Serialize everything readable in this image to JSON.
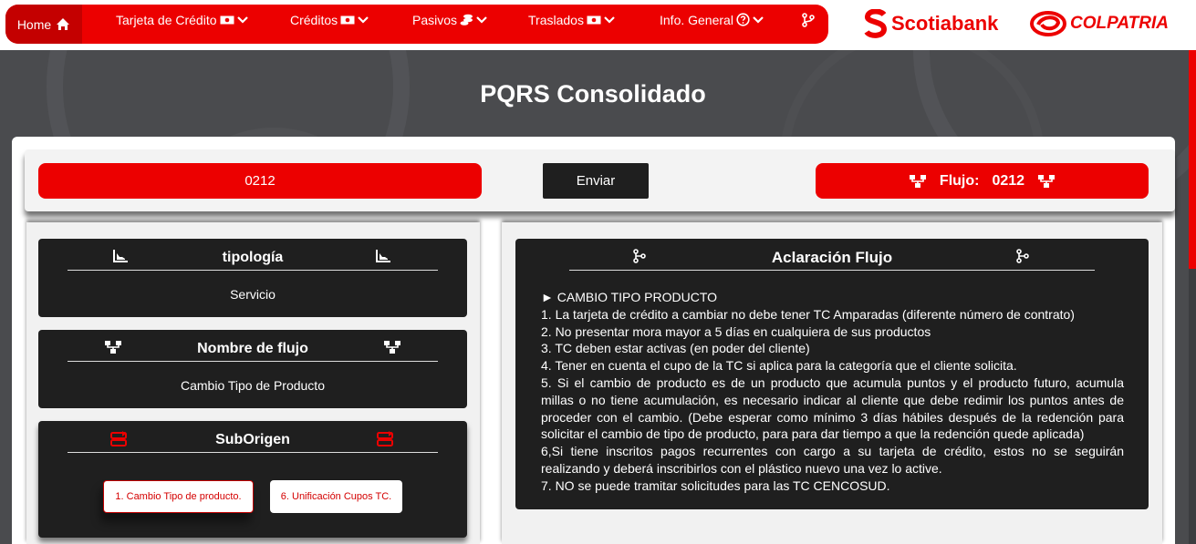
{
  "nav": {
    "home": "Home",
    "items": [
      {
        "label": "Tarjeta de Crédito"
      },
      {
        "label": "Créditos"
      },
      {
        "label": "Pasivos"
      },
      {
        "label": "Traslados"
      },
      {
        "label": "Info. General"
      }
    ]
  },
  "brand": {
    "scotiabank": "Scotiabank",
    "colpatria": "COLPATRIA"
  },
  "page": {
    "title": "PQRS Consolidado"
  },
  "search": {
    "value": "0212",
    "send_label": "Enviar",
    "flow_label": "Flujo:",
    "flow_value": "0212"
  },
  "cards": {
    "tipologia": {
      "title": "tipología",
      "value": "Servicio"
    },
    "nombre_flujo": {
      "title": "Nombre de flujo",
      "value": "Cambio Tipo de Producto"
    },
    "suborigen": {
      "title": "SubOrigen",
      "options": [
        "1. Cambio Tipo de producto.",
        "6. Unificación Cupos TC."
      ]
    },
    "aclaracion": {
      "title": "Aclaración Flujo",
      "lines": [
        "► CAMBIO TIPO PRODUCTO",
        "1. La tarjeta de crédito a cambiar no debe tener TC Amparadas (diferente número de contrato)",
        "2. No presentar mora mayor a 5 días en cualquiera de sus productos",
        "3. TC deben estar activas (en poder del cliente)",
        "4. Tener en cuenta el cupo de la TC si aplica para la categoría que el cliente solicita.",
        "5. Si el cambio de producto es de un producto que acumula puntos y el producto futuro, acumula millas o no tiene acumulación, es necesario indicar al cliente que debe redimir los puntos antes de proceder con el cambio. (Debe esperar como mínimo 3 días hábiles después de la redención para solicitar el cambio de tipo de producto, para para dar tiempo a que la redención quede aplicada)",
        "6,Si tiene inscritos pagos recurrentes con cargo a su tarjeta de crédito, estos no se seguirán realizando y deberá inscribirlos con el plástico nuevo una vez lo active.",
        "7. NO se puede tramitar solicitudes para las TC CENCOSUD."
      ]
    }
  },
  "colors": {
    "accent": "#ec0000",
    "dark": "#1f1f1f",
    "background": "#4a4b4e"
  }
}
